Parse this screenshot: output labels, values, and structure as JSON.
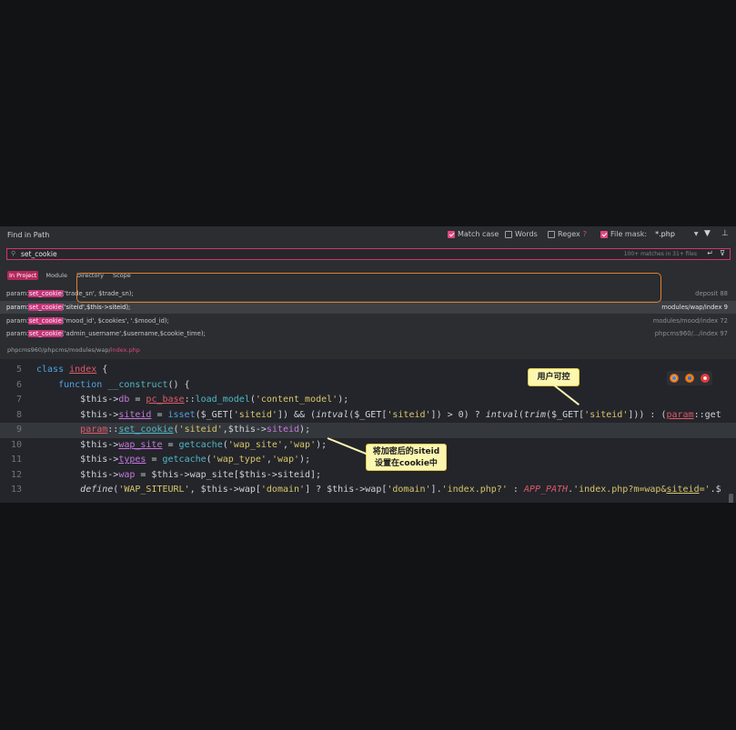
{
  "header": {
    "title": "Find in Path",
    "options": [
      {
        "label": "Match case",
        "checked": true
      },
      {
        "label": "Words",
        "checked": false
      },
      {
        "label": "Regex",
        "checked": false
      },
      {
        "label": "File mask:",
        "checked": true
      }
    ],
    "regex_help": "?",
    "file_mask_value": "*.php"
  },
  "search": {
    "query": "set_cookie",
    "match_count": "100+ matches in 31+ files"
  },
  "scope_tabs": [
    "In Project",
    "Module",
    "Directory",
    "Scope"
  ],
  "results": [
    {
      "prefix": "param::",
      "match": "set_cookie",
      "rest": "('trade_sn', $trade_sn);",
      "path": "deposit 88",
      "selected": false
    },
    {
      "prefix": "param::",
      "match": "set_cookie",
      "rest": "('siteid',$this->siteid);",
      "path": "modules/wap/index 9",
      "selected": true
    },
    {
      "prefix": "param::",
      "match": "set_cookie",
      "rest": "('mood_id', $cookies', '.$mood_id);",
      "path": "modules/mood/index 72",
      "selected": false
    },
    {
      "prefix": "param::",
      "match": "set_cookie",
      "rest": "('admin_username',$username,$cookie_time);",
      "path": "phpcms960/.../index 97",
      "selected": false
    }
  ],
  "file_path": {
    "dir": "phpcms960/phpcms/modules/wap/",
    "file": "index.php"
  },
  "editor": {
    "line_numbers": [
      "5",
      "6",
      "7",
      "8",
      "9",
      "10",
      "11",
      "12",
      "13"
    ],
    "current_line": "9"
  },
  "annotations": {
    "user_controllable": "用户可控",
    "siteid_cookie_line1": "将加密后的siteid",
    "siteid_cookie_line2": "设置在cookie中"
  },
  "colors": {
    "accent": "#e0467f",
    "highlight_border": "#e27d2e",
    "callout_bg": "#fbf6b0"
  }
}
